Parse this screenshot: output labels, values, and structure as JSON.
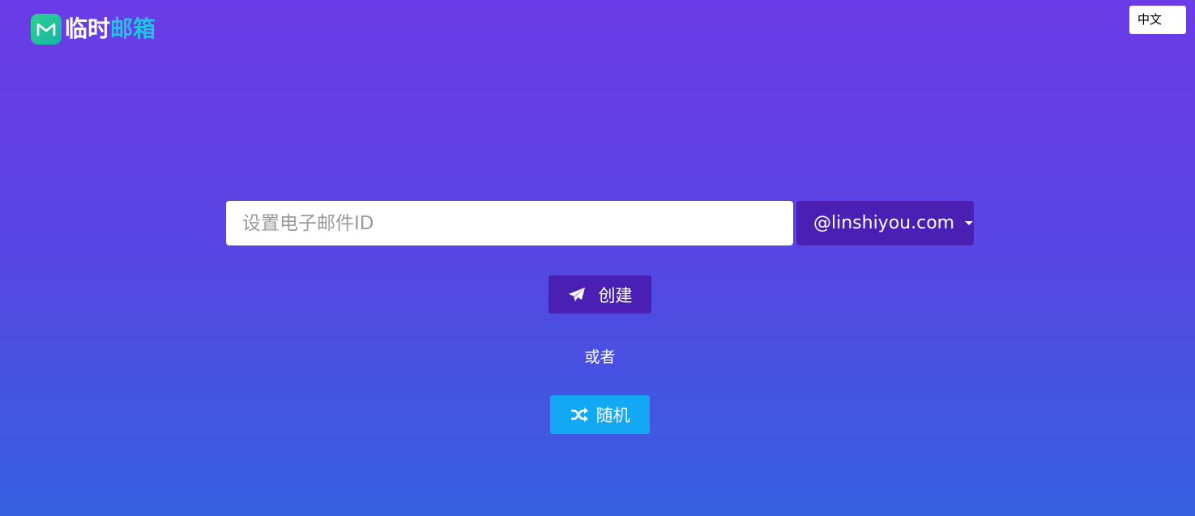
{
  "header": {
    "logo_icon": "mail-m-icon",
    "logo_text_part1": "临时",
    "logo_text_part2": "邮箱",
    "colors": {
      "logo_badge": "#22c39a",
      "logo_accent": "#21c4e0"
    }
  },
  "language": {
    "selected": "中文"
  },
  "form": {
    "email_placeholder": "设置电子邮件ID",
    "email_value": "",
    "domain_selected": "@linshiyou.com",
    "domain_caret_icon": "caret-down-icon"
  },
  "actions": {
    "create_icon": "paper-plane-icon",
    "create_label": "创建",
    "or_label": "或者",
    "random_icon": "shuffle-icon",
    "random_label": "随机"
  },
  "colors": {
    "background_top": "#6b3be6",
    "background_bottom": "#3560e2",
    "primary_button": "#4a1fb4",
    "random_button": "#13a8f4"
  }
}
